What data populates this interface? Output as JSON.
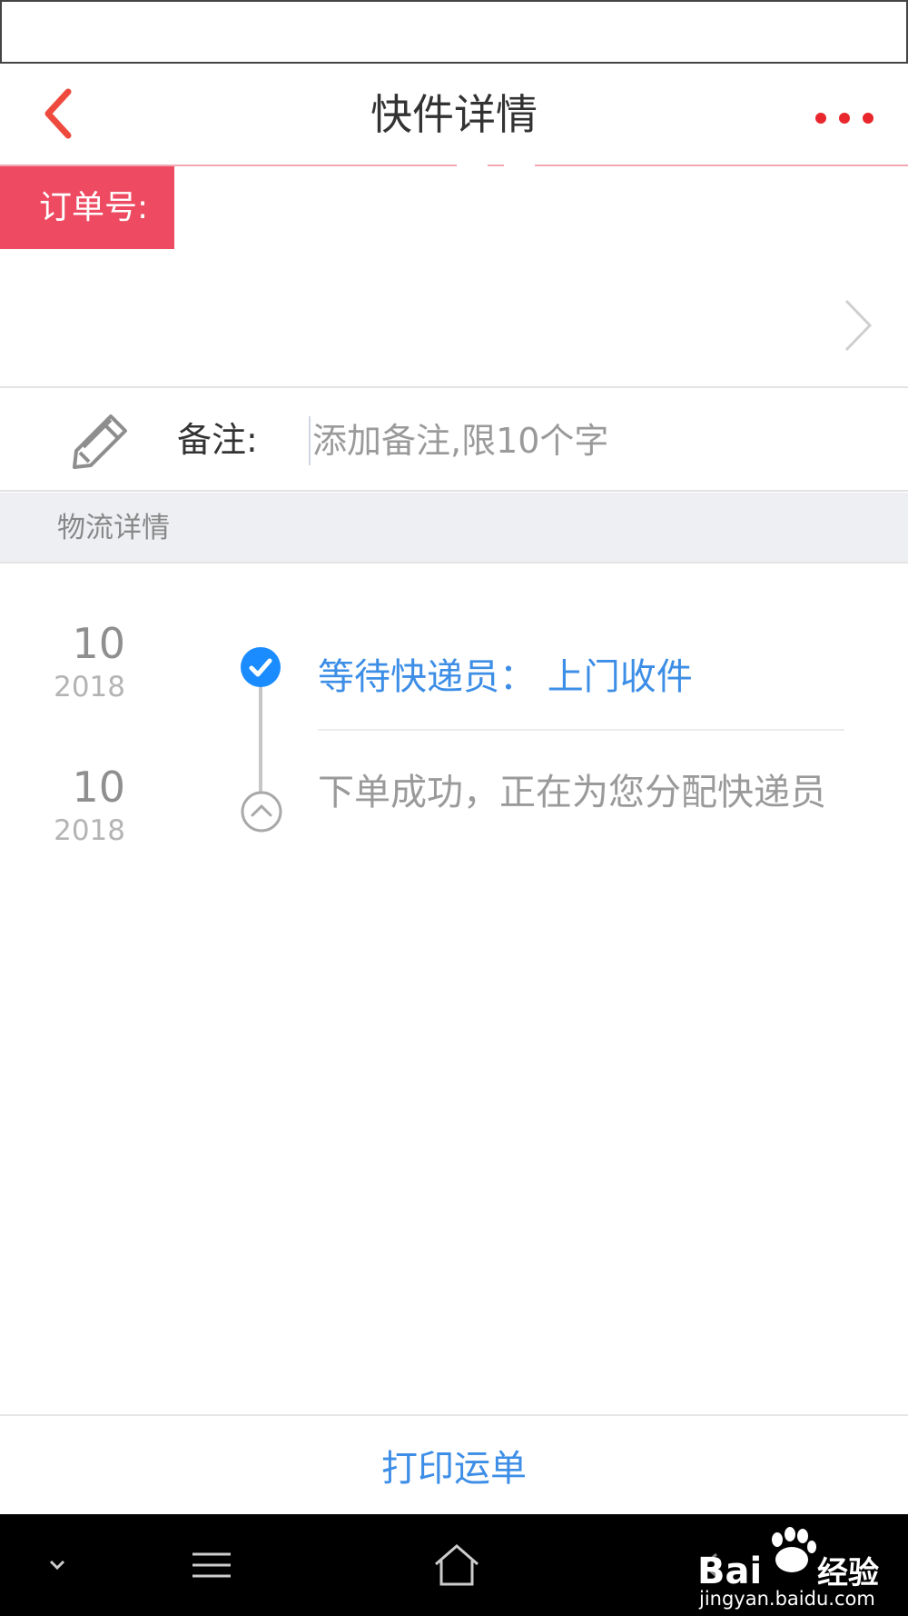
{
  "nav": {
    "title": "快件详情"
  },
  "order": {
    "label": "订单号:"
  },
  "remark": {
    "label": "备注:",
    "placeholder": "添加备注,限10个字"
  },
  "logistics": {
    "section_title": "物流详情",
    "events": [
      {
        "day": "10",
        "year": "2018",
        "text": "等待快递员： 上门收件",
        "status": "current"
      },
      {
        "day": "10",
        "year": "2018",
        "text": "下单成功，正在为您分配快递员",
        "status": "past"
      }
    ]
  },
  "actions": {
    "print_label": "打印运单"
  },
  "colors": {
    "accent_red": "#ee4b62",
    "link_blue": "#3d8ee6",
    "timeline_blue": "#1a8cff"
  },
  "icons": {
    "back": "back-arrow-icon",
    "more": "more-dots-icon",
    "chevron": "chevron-right-icon",
    "pencil": "pencil-icon",
    "check": "check-circle-icon",
    "up": "chevron-up-circle-icon"
  },
  "watermark": {
    "brand": "Bai",
    "brand_cn": "经验",
    "url": "jingyan.baidu.com"
  }
}
